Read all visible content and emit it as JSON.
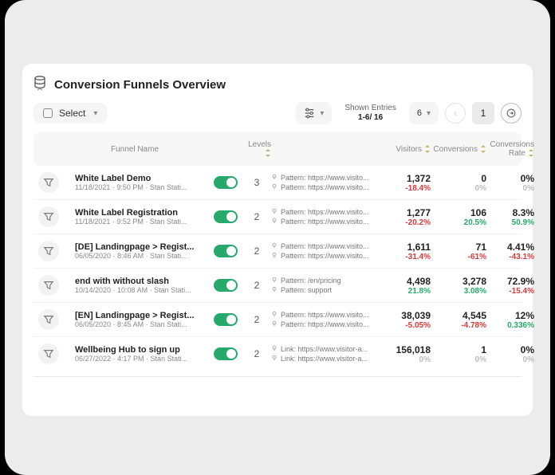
{
  "header": {
    "title": "Conversion Funnels Overview"
  },
  "toolbar": {
    "select_label": "Select",
    "shown_label": "Shown Entries",
    "shown_range": "1-6/ 16",
    "page_size": "6",
    "current_page": "1"
  },
  "columns": {
    "name": "Funnel Name",
    "levels": "Levels",
    "visitors": "Visitors",
    "conversions": "Conversions",
    "rate": "Conversions Rate"
  },
  "rows": [
    {
      "name": "White Label Demo",
      "meta": "11/18/2021 · 9:50 PM · Stan Stati...",
      "levels": "3",
      "p1": "Pattern: https://www.visito...",
      "p2": "Pattern: https://www.visito...",
      "visitors": "1,372",
      "visitors_delta": "-18.4%",
      "visitors_sign": "neg",
      "conversions": "0",
      "conversions_delta": "0%",
      "conversions_sign": "zero",
      "rate": "0%",
      "rate_delta": "0%",
      "rate_sign": "zero"
    },
    {
      "name": "White Label Registration",
      "meta": "11/18/2021 · 9:52 PM · Stan Stati...",
      "levels": "2",
      "p1": "Pattern: https://www.visito...",
      "p2": "Pattern: https://www.visito...",
      "visitors": "1,277",
      "visitors_delta": "-20.2%",
      "visitors_sign": "neg",
      "conversions": "106",
      "conversions_delta": "20.5%",
      "conversions_sign": "pos",
      "rate": "8.3%",
      "rate_delta": "50.9%",
      "rate_sign": "pos"
    },
    {
      "name": "[DE] Landingpage > Regist...",
      "meta": "06/05/2020 · 8:46 AM · Stan Stati...",
      "levels": "2",
      "p1": "Pattern: https://www.visito...",
      "p2": "Pattern: https://www.visito...",
      "visitors": "1,611",
      "visitors_delta": "-31.4%",
      "visitors_sign": "neg",
      "conversions": "71",
      "conversions_delta": "-61%",
      "conversions_sign": "neg",
      "rate": "4.41%",
      "rate_delta": "-43.1%",
      "rate_sign": "neg"
    },
    {
      "name": "end with without slash",
      "meta": "10/14/2020 · 10:08 AM · Stan Stati...",
      "levels": "2",
      "p1": "Pattern: /en/pricing",
      "p2": "Pattern: support",
      "visitors": "4,498",
      "visitors_delta": "21.8%",
      "visitors_sign": "pos",
      "conversions": "3,278",
      "conversions_delta": "3.08%",
      "conversions_sign": "pos",
      "rate": "72.9%",
      "rate_delta": "-15.4%",
      "rate_sign": "neg"
    },
    {
      "name": "[EN] Landingpage > Regist...",
      "meta": "06/05/2020 · 8:45 AM · Stan Stati...",
      "levels": "2",
      "p1": "Pattern: https://www.visito...",
      "p2": "Pattern: https://www.visito...",
      "visitors": "38,039",
      "visitors_delta": "-5.05%",
      "visitors_sign": "neg",
      "conversions": "4,545",
      "conversions_delta": "-4.78%",
      "conversions_sign": "neg",
      "rate": "12%",
      "rate_delta": "0.336%",
      "rate_sign": "pos"
    },
    {
      "name": "Wellbeing Hub to sign up",
      "meta": "06/27/2022 · 4:17 PM · Stan Stati...",
      "levels": "2",
      "p1": "Link: https://www.visitor-a...",
      "p2": "Link: https://www.visitor-a...",
      "visitors": "156,018",
      "visitors_delta": "0%",
      "visitors_sign": "zero",
      "conversions": "1",
      "conversions_delta": "0%",
      "conversions_sign": "zero",
      "rate": "0%",
      "rate_delta": "0%",
      "rate_sign": "zero"
    }
  ]
}
